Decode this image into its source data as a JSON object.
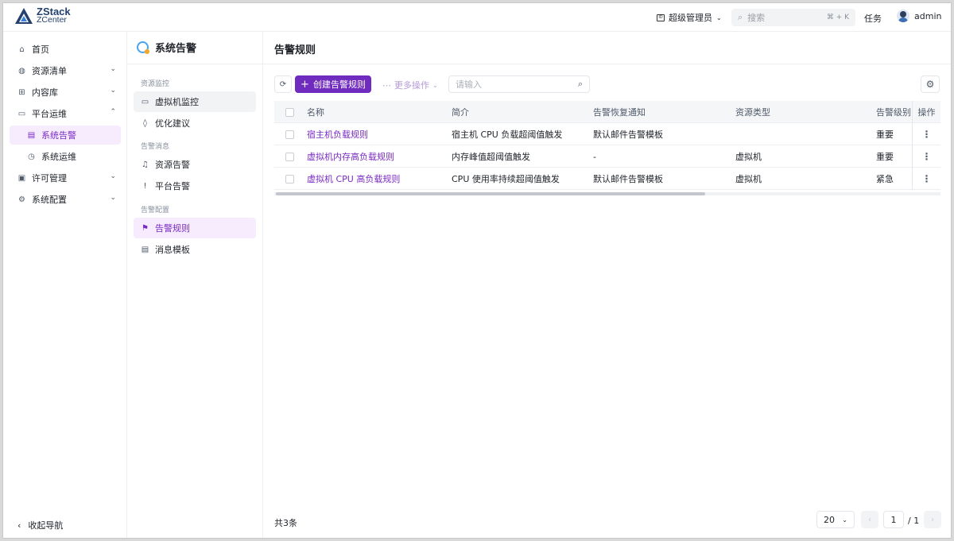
{
  "app": {
    "logo_title": "ZStack",
    "logo_subtitle": "ZCenter",
    "role": "超级管理员",
    "search_placeholder": "搜索",
    "search_shortcut": "⌘ + K",
    "tasks": "任务",
    "user": "admin"
  },
  "leftnav": {
    "items": [
      {
        "label": "首页",
        "icon": "home-icon"
      },
      {
        "label": "资源清单",
        "icon": "globe-icon"
      },
      {
        "label": "内容库",
        "icon": "library-icon"
      },
      {
        "label": "平台运维",
        "icon": "inbox-icon"
      },
      {
        "label": "系统告警",
        "icon": "document-icon"
      },
      {
        "label": "系统运维",
        "icon": "clock-icon"
      },
      {
        "label": "许可管理",
        "icon": "license-icon"
      },
      {
        "label": "系统配置",
        "icon": "gear-icon"
      }
    ],
    "collapse": "收起导航"
  },
  "subnav": {
    "title": "系统告警",
    "groups": {
      "monitor": "资源监控",
      "messages": "告警消息",
      "config": "告警配置"
    },
    "items": {
      "vm_monitor": "虚拟机监控",
      "optimize": "优化建议",
      "resource_alarm": "资源告警",
      "platform_alarm": "平台告警",
      "alarm_rules": "告警规则",
      "msg_template": "消息模板"
    }
  },
  "main": {
    "title": "告警规则",
    "create_label": "创建告警规则",
    "more_label": "更多操作",
    "search_placeholder": "请输入",
    "columns": {
      "name": "名称",
      "desc": "简介",
      "notify": "告警恢复通知",
      "type": "资源类型",
      "level": "告警级别",
      "ops": "操作"
    },
    "rows": [
      {
        "name": "宿主机负载规则",
        "desc": "宿主机 CPU 负载超阈值触发",
        "notify": "默认邮件告警模板",
        "type": "",
        "level": "重要"
      },
      {
        "name": "虚拟机内存高负载规则",
        "desc": "内存峰值超阈值触发",
        "notify": "-",
        "type": "虚拟机",
        "level": "重要"
      },
      {
        "name": "虚拟机 CPU 高负载规则",
        "desc": "CPU 使用率持续超阈值触发",
        "notify": "默认邮件告警模板",
        "type": "虚拟机",
        "level": "紧急"
      }
    ],
    "total": "共3条",
    "page_size": "20",
    "page": "1",
    "page_total": "/ 1"
  }
}
